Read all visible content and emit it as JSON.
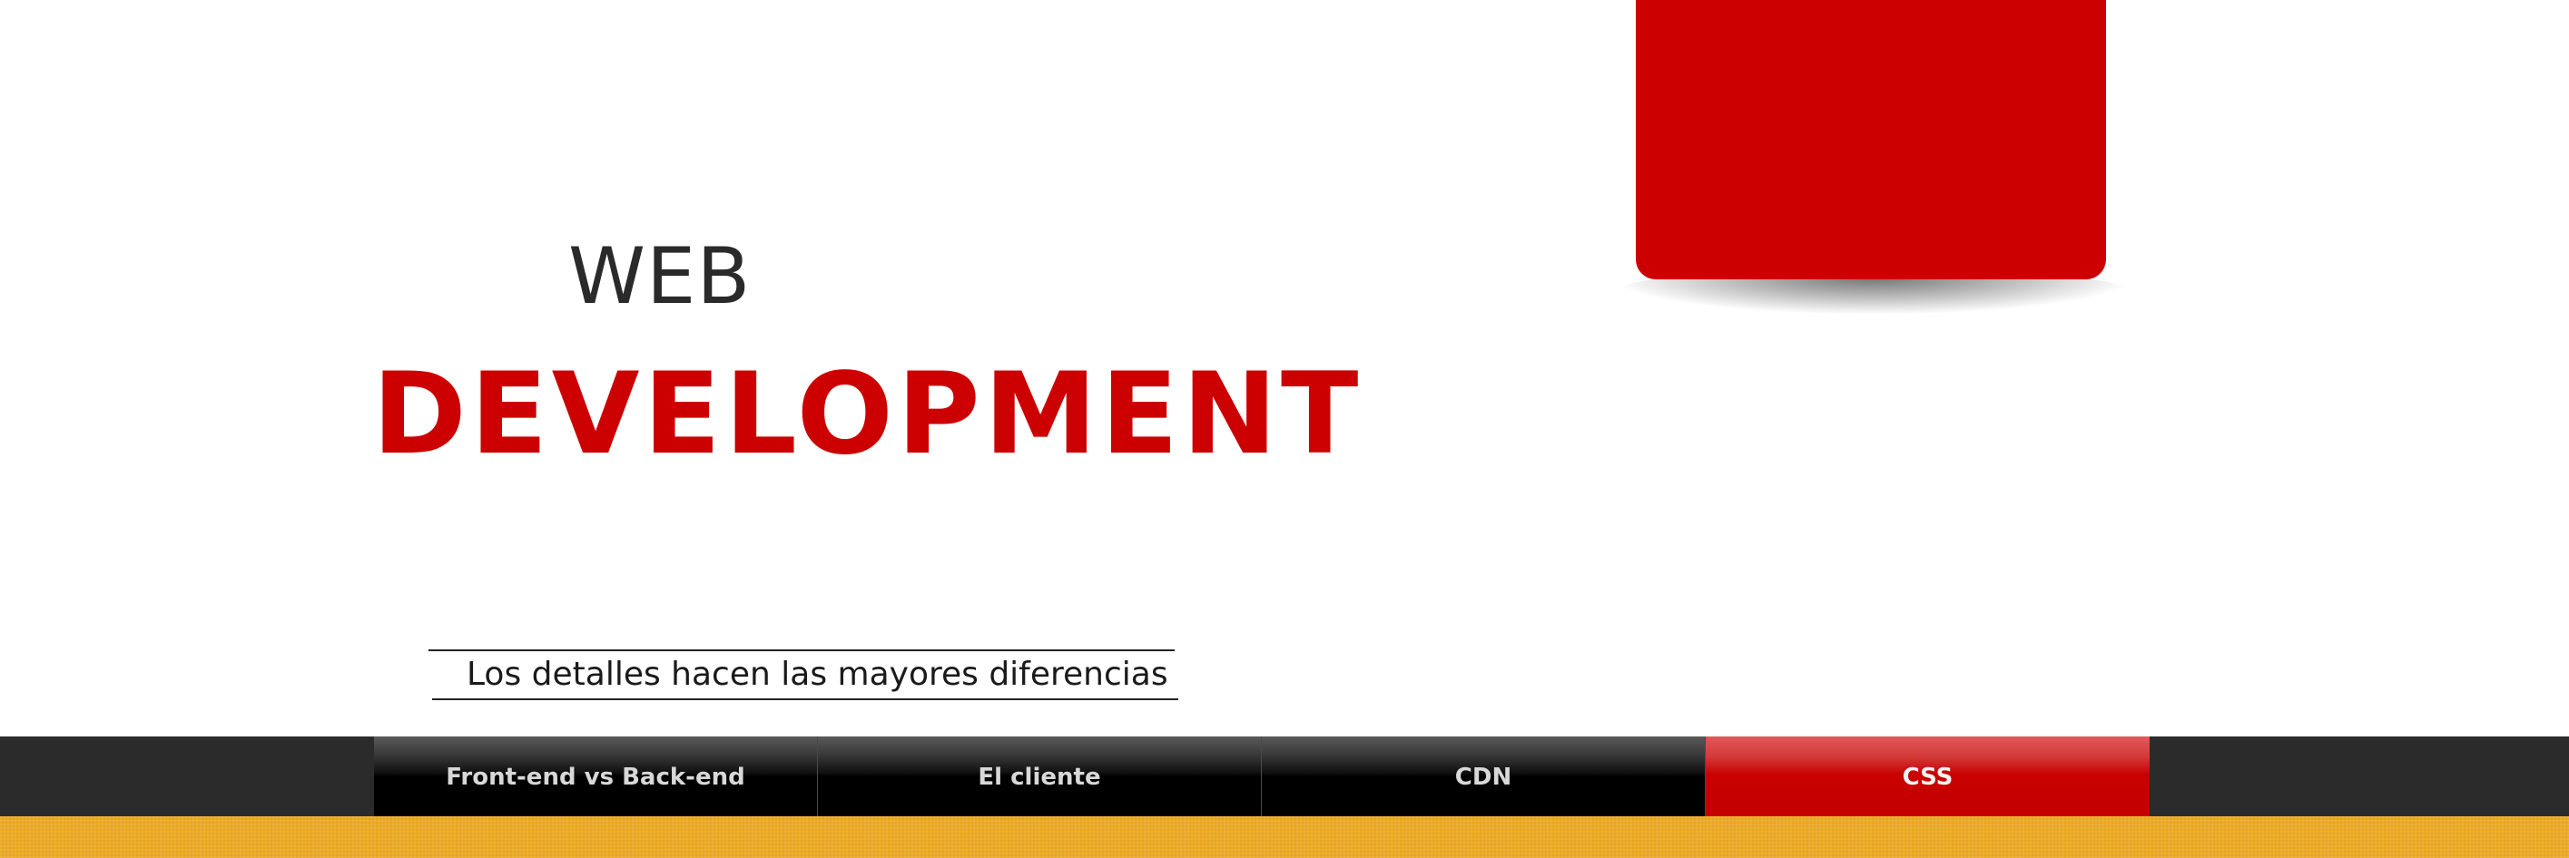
{
  "hero": {
    "line1": "WEB",
    "line2": "DEVELOPMENT",
    "tagline": "Los detalles hacen las mayores diferencias"
  },
  "nav": {
    "items": [
      {
        "label": "Front-end vs Back-end",
        "active": false
      },
      {
        "label": "El cliente",
        "active": false
      },
      {
        "label": "CDN",
        "active": false
      },
      {
        "label": "CSS",
        "active": true
      }
    ]
  },
  "colors": {
    "accent_red": "#cc0000",
    "navbar_bg": "#2b2b2b",
    "stripe_yellow": "#e8a41a",
    "text_dark": "#2a2a2a"
  }
}
